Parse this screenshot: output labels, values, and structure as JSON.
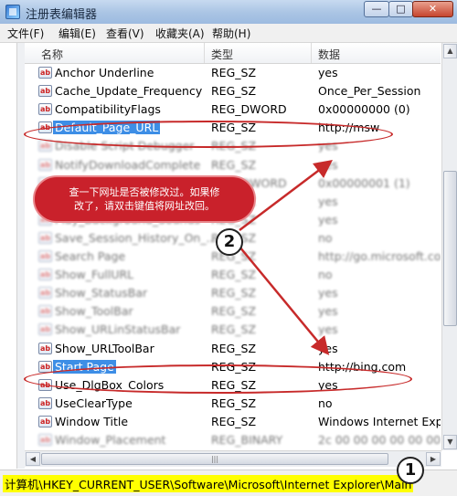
{
  "window": {
    "title": "注册表编辑器",
    "min_glyph": "—",
    "max_glyph": "□",
    "close_glyph": "✕"
  },
  "menu": [
    "文件(F)",
    "编辑(E)",
    "查看(V)",
    "收藏夹(A)",
    "帮助(H)"
  ],
  "columns": {
    "name": "名称",
    "type": "类型",
    "data": "数据"
  },
  "value_icon_text": "ab",
  "rows": [
    {
      "name": "Anchor Underline",
      "type": "REG_SZ",
      "data": "yes",
      "state": "normal"
    },
    {
      "name": "Cache_Update_Frequency",
      "type": "REG_SZ",
      "data": "Once_Per_Session",
      "state": "normal"
    },
    {
      "name": "CompatibilityFlags",
      "type": "REG_DWORD",
      "data": "0x00000000 (0)",
      "state": "normal"
    },
    {
      "name": "Default_Page_URL",
      "type": "REG_SZ",
      "data": "http://msw",
      "state": "selected"
    },
    {
      "name": "Disable Script Debugger",
      "type": "REG_SZ",
      "data": "yes",
      "state": "blurred"
    },
    {
      "name": "NotifyDownloadComplete",
      "type": "REG_SZ",
      "data": "yes",
      "state": "blurred"
    },
    {
      "name": "",
      "type": "REG_DWORD",
      "data": "0x00000001 (1)",
      "state": "blurred"
    },
    {
      "name": "",
      "type": "REG_SZ",
      "data": "yes",
      "state": "blurred"
    },
    {
      "name": "Play_Background_Sounds",
      "type": "REG_SZ",
      "data": "yes",
      "state": "blurred"
    },
    {
      "name": "Save_Session_History_On_...",
      "type": "REG_SZ",
      "data": "no",
      "state": "blurred"
    },
    {
      "name": "Search Page",
      "type": "REG_SZ",
      "data": "http://go.microsoft.co",
      "state": "blurred"
    },
    {
      "name": "Show_FullURL",
      "type": "REG_SZ",
      "data": "no",
      "state": "blurred"
    },
    {
      "name": "Show_StatusBar",
      "type": "REG_SZ",
      "data": "yes",
      "state": "blurred"
    },
    {
      "name": "Show_ToolBar",
      "type": "REG_SZ",
      "data": "yes",
      "state": "blurred"
    },
    {
      "name": "Show_URLinStatusBar",
      "type": "REG_SZ",
      "data": "yes",
      "state": "blurred"
    },
    {
      "name": "Show_URLToolBar",
      "type": "REG_SZ",
      "data": "yes",
      "state": "normal"
    },
    {
      "name": "Start Page",
      "type": "REG_SZ",
      "data": "http://bing.com",
      "state": "selected"
    },
    {
      "name": "Use_DlgBox_Colors",
      "type": "REG_SZ",
      "data": "yes",
      "state": "normal"
    },
    {
      "name": "UseClearType",
      "type": "REG_SZ",
      "data": "no",
      "state": "normal"
    },
    {
      "name": "Window Title",
      "type": "REG_SZ",
      "data": "Windows Internet Exp",
      "state": "normal"
    },
    {
      "name": "Window_Placement",
      "type": "REG_BINARY",
      "data": "2c 00 00 00 00 00 00",
      "state": "blurred"
    }
  ],
  "status_path": "计算机\\HKEY_CURRENT_USER\\Software\\Microsoft\\Internet Explorer\\Main",
  "annotation": {
    "text_line1": "查一下网址是否被修改过。如果修",
    "text_line2": "改了，请双击键值将网址改回。",
    "badge1": "1",
    "badge2": "2"
  },
  "colors": {
    "annotation_red": "#c72a2a",
    "selection_blue": "#3d8ee6",
    "status_highlight": "#ffff00"
  }
}
